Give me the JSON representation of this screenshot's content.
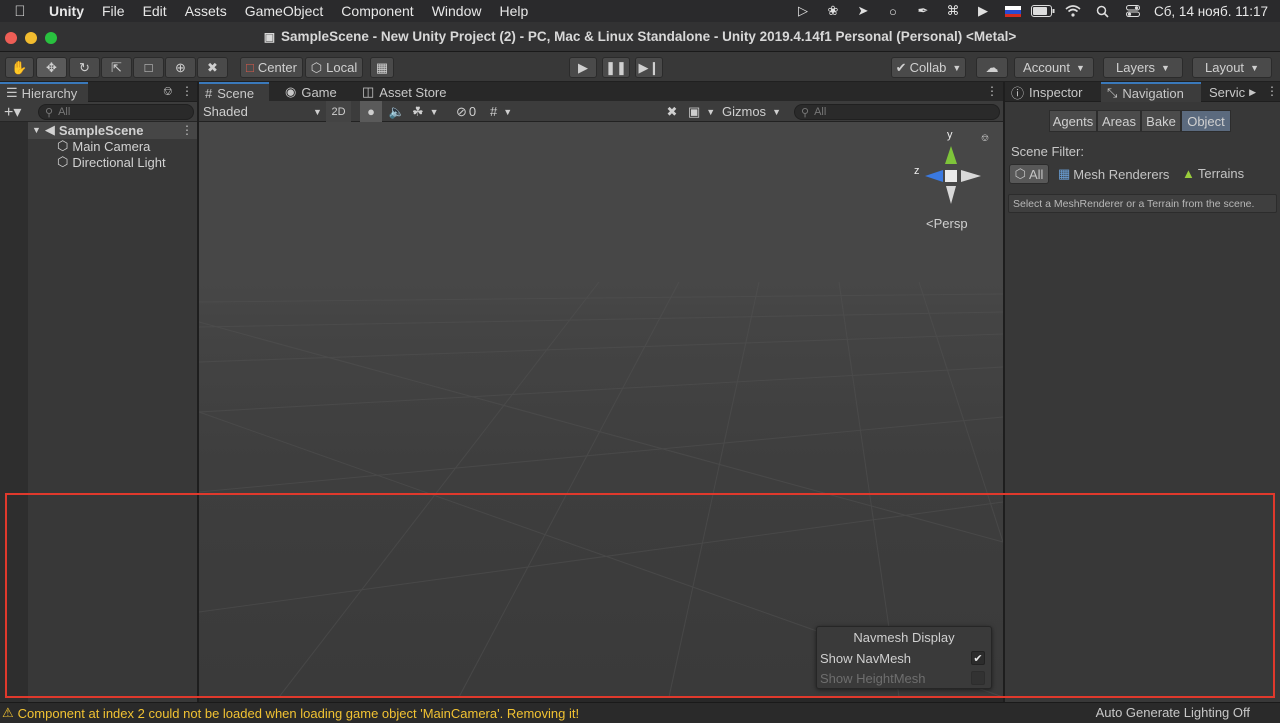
{
  "menubar": {
    "app": "Unity",
    "items": [
      "File",
      "Edit",
      "Assets",
      "GameObject",
      "Component",
      "Window",
      "Help"
    ],
    "clock": "Сб, 14 нояб. 11:17"
  },
  "window": {
    "title": "SampleScene - New Unity Project (2) - PC, Mac & Linux Standalone - Unity 2019.4.14f1 Personal (Personal) <Metal>"
  },
  "toolbar": {
    "pivot": "Center",
    "space": "Local",
    "collab": "Collab",
    "account": "Account",
    "layers": "Layers",
    "layout": "Layout"
  },
  "hierarchy": {
    "tab": "Hierarchy",
    "search_placeholder": "All",
    "scene": "SampleScene",
    "items": [
      "Main Camera",
      "Directional Light"
    ]
  },
  "scene_tabs": [
    "Scene",
    "Game",
    "Asset Store"
  ],
  "scene_toolbar": {
    "shading": "Shaded",
    "mode2d": "2D",
    "hidden_count": "0",
    "gizmos": "Gizmos",
    "search_placeholder": "All"
  },
  "gizmo": {
    "y": "y",
    "z": "z",
    "persp": "Persp"
  },
  "right_tabs": [
    "Inspector",
    "Navigation",
    "Servic"
  ],
  "navigation": {
    "buttons": [
      "Agents",
      "Areas",
      "Bake",
      "Object"
    ],
    "scene_filter_label": "Scene Filter:",
    "filters": [
      "All",
      "Mesh Renderers",
      "Terrains"
    ],
    "hint": "Select a MeshRenderer or a Terrain from the scene."
  },
  "navmesh_display": {
    "title": "Navmesh Display",
    "show_navmesh": "Show NavMesh",
    "show_heightmesh": "Show HeightMesh"
  },
  "status": {
    "warning": "Component at index 2 could not be loaded when loading game object 'MainCamera'. Removing it!",
    "lighting": "Auto Generate Lighting Off"
  }
}
